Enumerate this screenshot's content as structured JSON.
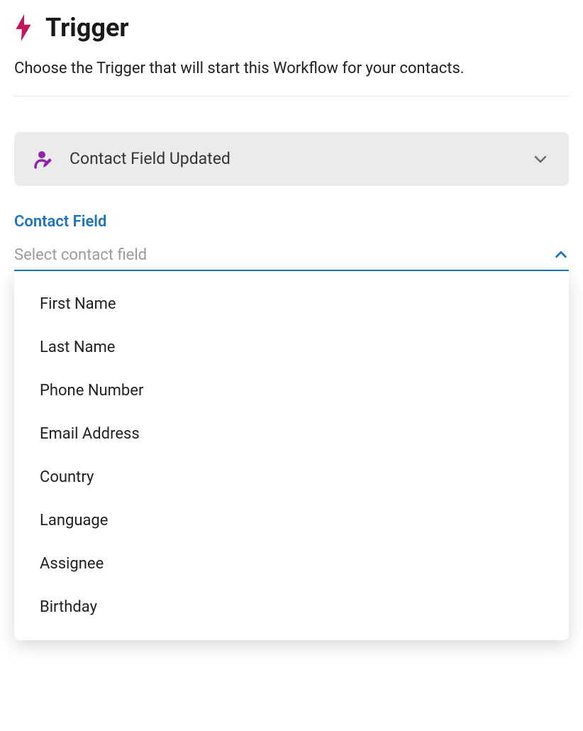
{
  "header": {
    "title": "Trigger",
    "description": "Choose the Trigger that will start this Workflow for your contacts."
  },
  "trigger_card": {
    "title": "Contact Field Updated"
  },
  "field_section": {
    "label": "Contact Field",
    "placeholder": "Select contact field",
    "options": [
      "First Name",
      "Last Name",
      "Phone Number",
      "Email Address",
      "Country",
      "Language",
      "Assignee",
      "Birthday"
    ]
  },
  "colors": {
    "accent_pink": "#c2185b",
    "accent_purple": "#8e24aa",
    "accent_blue": "#1e73be"
  }
}
